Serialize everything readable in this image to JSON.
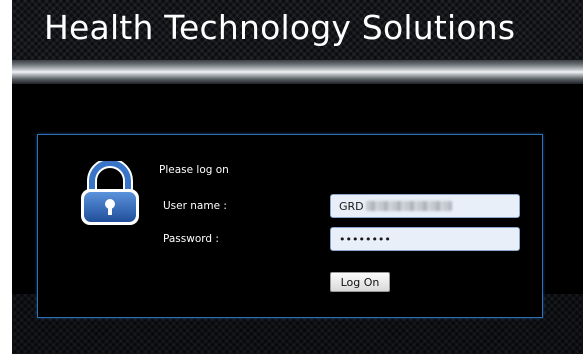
{
  "header": {
    "app_title": "Health Technology Solutions"
  },
  "login": {
    "prompt": "Please log on",
    "username_label": "User name :",
    "username_value": "GRD",
    "password_label": "Password :",
    "password_value": "••••••••",
    "logon_button_label": "Log On",
    "icon": "lock-icon"
  },
  "colors": {
    "panel_border": "#2f6fb4",
    "lock_blue": "#2f67b8",
    "input_background": "#e8eff8"
  }
}
